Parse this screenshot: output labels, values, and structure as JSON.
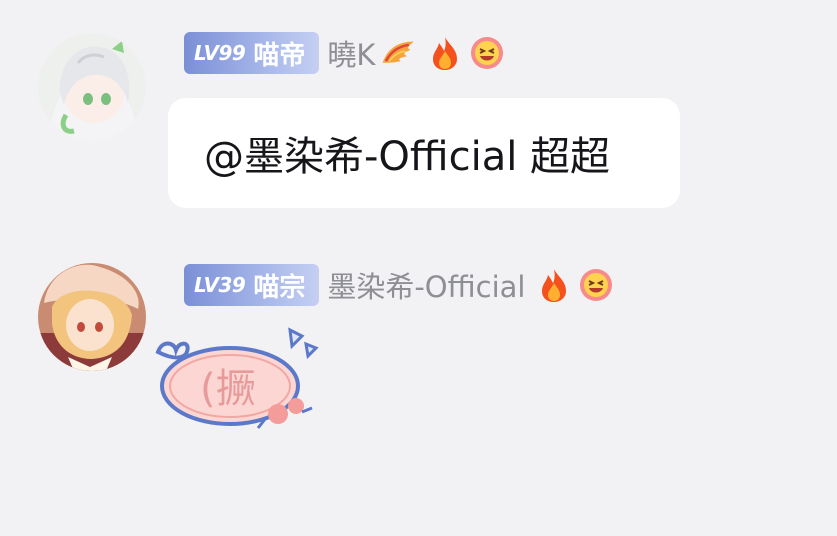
{
  "messages": [
    {
      "level": "LV99",
      "title": "喵帝",
      "nickname": "曉K",
      "badges": [
        "dragon-wing-icon",
        "fire-icon",
        "grin-face-icon"
      ],
      "text": "@墨染希-Official 超超",
      "avatar": "avatar-anime-girl-white-hair"
    },
    {
      "level": "LV39",
      "title": "喵宗",
      "nickname": "墨染希-Official",
      "badges": [
        "fire-icon",
        "grin-face-icon"
      ],
      "sticker_text": "(撅",
      "avatar": "avatar-anime-girl-blonde"
    }
  ],
  "colors": {
    "background": "#f2f1f3",
    "badge_gradient_start": "#7b8fd6",
    "bubble": "#ffffff",
    "nickname": "#8e8e95",
    "sticker_text": "#e89a9a"
  }
}
